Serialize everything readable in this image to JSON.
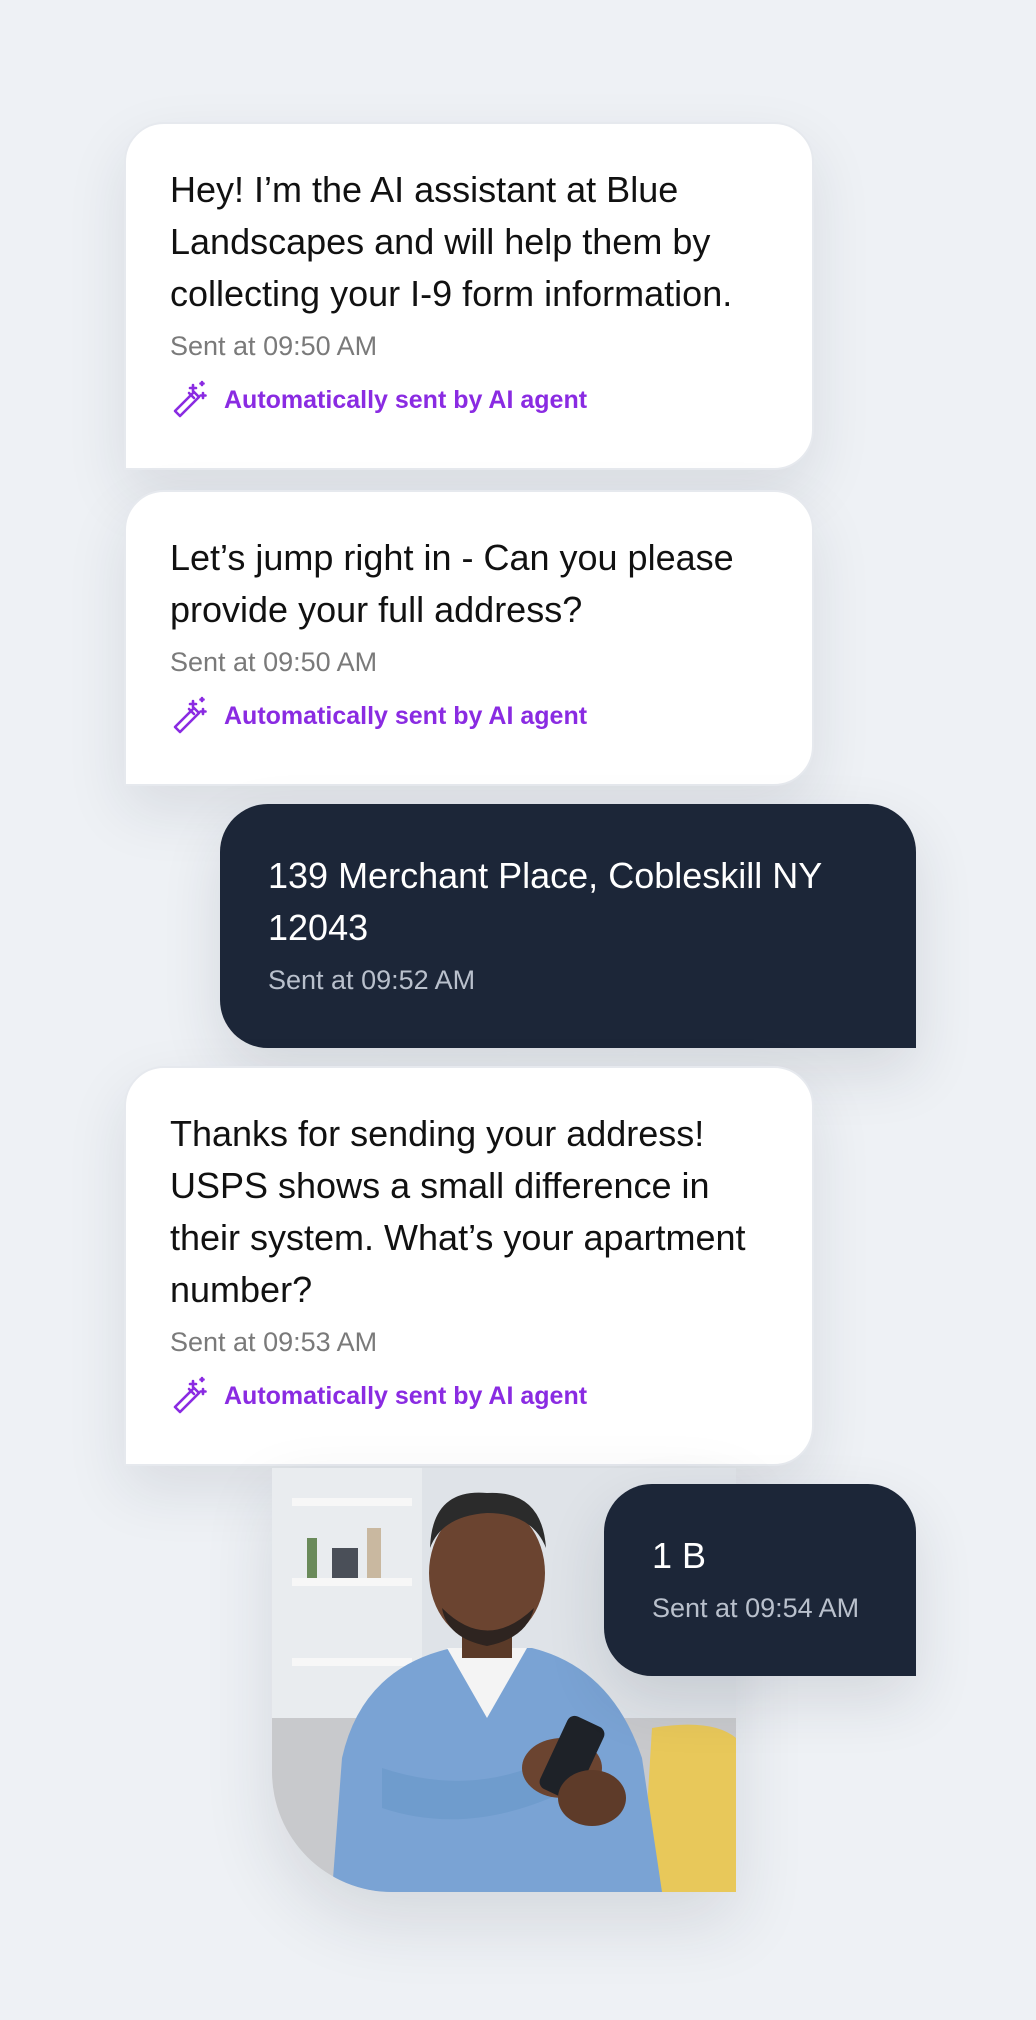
{
  "messages": [
    {
      "sender": "ai",
      "text": "Hey! I’m the AI assistant at Blue Landscapes and will help them by collecting your I-9 form information.",
      "time": "Sent at 09:50 AM",
      "tag": "Automatically sent by AI agent"
    },
    {
      "sender": "ai",
      "text": "Let’s jump right in - Can you please provide your full address?",
      "time": "Sent at 09:50 AM",
      "tag": "Automatically sent by AI agent"
    },
    {
      "sender": "user",
      "text": "139 Merchant Place, Cobleskill NY 12043",
      "time": "Sent at 09:52 AM"
    },
    {
      "sender": "ai",
      "text": "Thanks for sending your address! USPS shows a small difference in their system. What’s your apartment number?",
      "time": "Sent at 09:53 AM",
      "tag": "Automatically sent by AI agent"
    },
    {
      "sender": "user",
      "text": "1 B",
      "time": "Sent at 09:54 AM"
    }
  ],
  "icons": {
    "ai_tag_icon": "magic-wand-icon"
  },
  "colors": {
    "background": "#eef1f5",
    "ai_bubble": "#ffffff",
    "user_bubble": "#1c2638",
    "ai_tag": "#8a2be2"
  }
}
